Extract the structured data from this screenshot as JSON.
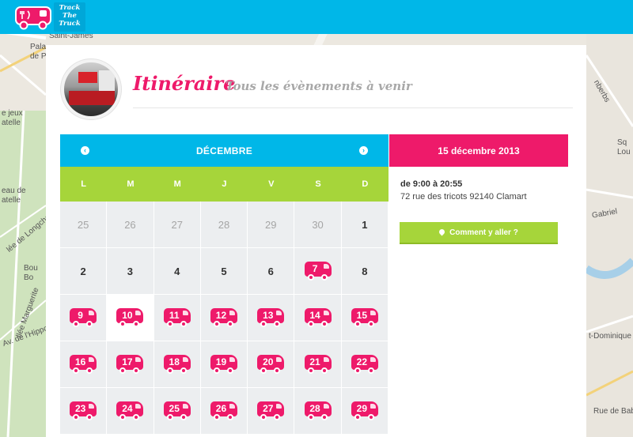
{
  "app": {
    "logo_line1": "Track",
    "logo_line2": "The",
    "logo_line3": "Truck"
  },
  "map": {
    "labels": [
      "Saint-James",
      "Pala",
      "de P",
      "e jeux",
      "atelle",
      "eau de",
      "atelle",
      "lée de Longcha",
      "Bou",
      "Bo",
      "llée Marguerite",
      "Av. de l'Hippo",
      "nberbs",
      "Sq",
      "Lou",
      "Gabriel",
      "t-Dominique",
      "Rue de Babyl"
    ]
  },
  "header": {
    "title": "Itinéraire",
    "subtitle": "Tous les évènements à venir"
  },
  "calendar": {
    "month": "DÉCEMBRE",
    "prev_icon": "chevron-left-icon",
    "next_icon": "chevron-right-icon",
    "weekdays": [
      "L",
      "M",
      "M",
      "J",
      "V",
      "S",
      "D"
    ],
    "cells": [
      {
        "day": "25",
        "muted": true,
        "event": false
      },
      {
        "day": "26",
        "muted": true,
        "event": false
      },
      {
        "day": "27",
        "muted": true,
        "event": false
      },
      {
        "day": "28",
        "muted": true,
        "event": false
      },
      {
        "day": "29",
        "muted": true,
        "event": false
      },
      {
        "day": "30",
        "muted": true,
        "event": false
      },
      {
        "day": "1",
        "muted": false,
        "event": false
      },
      {
        "day": "2",
        "muted": false,
        "event": false
      },
      {
        "day": "3",
        "muted": false,
        "event": false
      },
      {
        "day": "4",
        "muted": false,
        "event": false
      },
      {
        "day": "5",
        "muted": false,
        "event": false
      },
      {
        "day": "6",
        "muted": false,
        "event": false
      },
      {
        "day": "7",
        "muted": false,
        "event": true
      },
      {
        "day": "8",
        "muted": false,
        "event": false
      },
      {
        "day": "9",
        "muted": false,
        "event": true
      },
      {
        "day": "10",
        "muted": false,
        "event": true,
        "today": true
      },
      {
        "day": "11",
        "muted": false,
        "event": true
      },
      {
        "day": "12",
        "muted": false,
        "event": true
      },
      {
        "day": "13",
        "muted": false,
        "event": true
      },
      {
        "day": "14",
        "muted": false,
        "event": true
      },
      {
        "day": "15",
        "muted": false,
        "event": true
      },
      {
        "day": "16",
        "muted": false,
        "event": true
      },
      {
        "day": "17",
        "muted": false,
        "event": true
      },
      {
        "day": "18",
        "muted": false,
        "event": true
      },
      {
        "day": "19",
        "muted": false,
        "event": true
      },
      {
        "day": "20",
        "muted": false,
        "event": true
      },
      {
        "day": "21",
        "muted": false,
        "event": true
      },
      {
        "day": "22",
        "muted": false,
        "event": true
      },
      {
        "day": "23",
        "muted": false,
        "event": true
      },
      {
        "day": "24",
        "muted": false,
        "event": true
      },
      {
        "day": "25",
        "muted": false,
        "event": true
      },
      {
        "day": "26",
        "muted": false,
        "event": true
      },
      {
        "day": "27",
        "muted": false,
        "event": true
      },
      {
        "day": "28",
        "muted": false,
        "event": true
      },
      {
        "day": "29",
        "muted": false,
        "event": true
      }
    ]
  },
  "event": {
    "date": "15 décembre 2013",
    "time": "de 9:00 à 20:55",
    "address": "72 rue des tricots 92140 Clamart",
    "button_label": "Comment y aller ?",
    "button_icon": "map-pin-icon"
  },
  "colors": {
    "brand_blue": "#00b7e8",
    "brand_pink": "#ee1a6a",
    "brand_green": "#a6d53a"
  }
}
